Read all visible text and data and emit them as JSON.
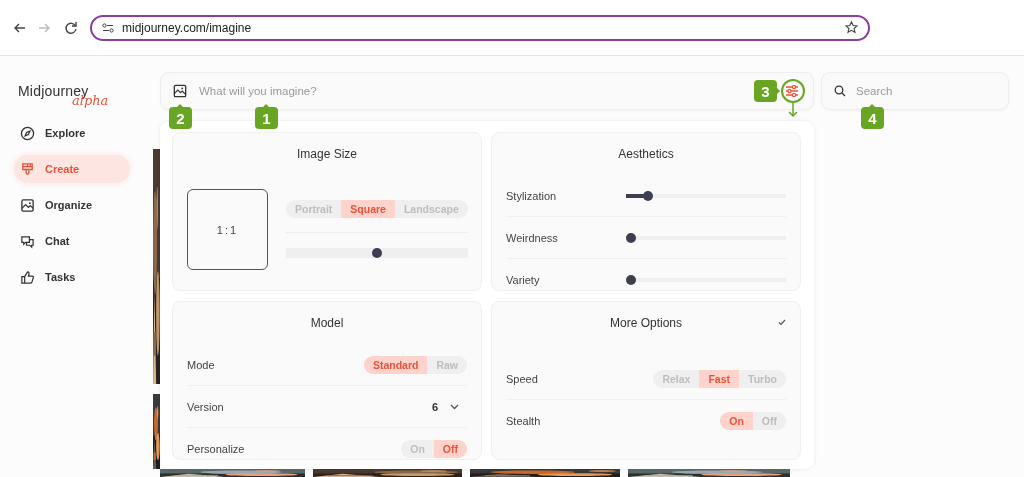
{
  "browser": {
    "nav": [
      {
        "kind": "back",
        "disabled": false
      },
      {
        "kind": "forward",
        "disabled": true
      },
      {
        "kind": "reload",
        "disabled": false
      }
    ],
    "url": "midjourney.com/imagine"
  },
  "sidebar": {
    "logo": "Midjourney",
    "logo_tag": "alpha",
    "items": [
      {
        "label": "Explore",
        "selected": false
      },
      {
        "label": "Create",
        "selected": true
      },
      {
        "label": "Organize",
        "selected": false
      },
      {
        "label": "Chat",
        "selected": false
      },
      {
        "label": "Tasks",
        "selected": false
      }
    ]
  },
  "prompt": {
    "placeholder": "What will you imagine?"
  },
  "search": {
    "placeholder": "Search"
  },
  "annotations": [
    {
      "label": "2"
    },
    {
      "label": "1"
    },
    {
      "label": "3"
    },
    {
      "label": "4"
    }
  ],
  "image_size": {
    "title": "Image Size",
    "ratio": "1:1",
    "options": [
      {
        "label": "Portrait",
        "selected": false
      },
      {
        "label": "Square",
        "selected": true
      },
      {
        "label": "Landscape",
        "selected": false
      }
    ],
    "level": 0.5
  },
  "aesthetics": {
    "title": "Aesthetics",
    "sliders": [
      {
        "label": "Stylization",
        "level": 0.11
      },
      {
        "label": "Weirdness",
        "level": 0
      },
      {
        "label": "Variety",
        "level": 0
      }
    ]
  },
  "model": {
    "title": "Model",
    "rows": [
      {
        "kind": "toggle",
        "label": "Mode",
        "options": [
          {
            "label": "Standard",
            "selected": true
          },
          {
            "label": "Raw",
            "selected": false
          }
        ]
      },
      {
        "kind": "select",
        "label": "Version",
        "value": "6"
      },
      {
        "kind": "toggle",
        "label": "Personalize",
        "options": [
          {
            "label": "On",
            "selected": false
          },
          {
            "label": "Off",
            "selected": true
          }
        ]
      }
    ]
  },
  "more_options": {
    "title": "More Options",
    "rows": [
      {
        "kind": "toggle",
        "label": "Speed",
        "options": [
          {
            "label": "Relax",
            "selected": false
          },
          {
            "label": "Fast",
            "selected": true
          },
          {
            "label": "Turbo",
            "selected": false
          }
        ]
      },
      {
        "kind": "toggle",
        "label": "Stealth",
        "options": [
          {
            "label": "On",
            "selected": true
          },
          {
            "label": "Off",
            "selected": false
          }
        ]
      }
    ]
  }
}
